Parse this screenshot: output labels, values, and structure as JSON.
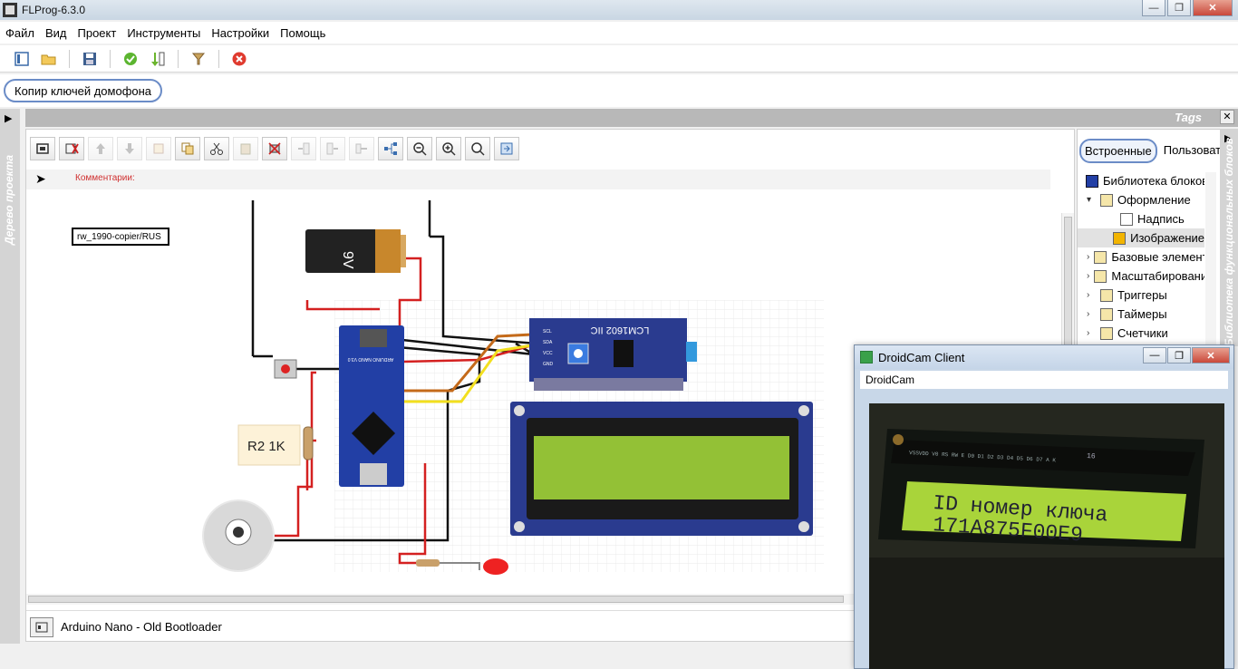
{
  "app": {
    "title": "FLProg-6.3.0"
  },
  "window_controls": {
    "minimize": "—",
    "maximize": "❐",
    "close": "✕"
  },
  "menu": [
    "Файл",
    "Вид",
    "Проект",
    "Инструменты",
    "Настройки",
    "Помощь"
  ],
  "project": {
    "tab_label": "Копир ключей домофона"
  },
  "left_panel": {
    "label": "Дерево проекта"
  },
  "tags_panel": {
    "label": "Tags",
    "hidden_title": "Tags"
  },
  "editor": {
    "comment_label": "Комментарии:",
    "name_box": "rw_1990-copier/RUS",
    "board_label": "Arduino Nano - Old Bootloader"
  },
  "schematic": {
    "battery_label": "9V",
    "resistor_label": "R2 1K",
    "lcd_module_label": "LCM1602 IIC",
    "i2c_pins": [
      "SCL",
      "SDA",
      "VCC",
      "GND"
    ],
    "nano_label": "ARDUINO NANO V3.0"
  },
  "library": {
    "tabs": [
      "Встроенные",
      "Пользоват"
    ],
    "items": [
      {
        "label": "Библиотека блоков",
        "indent": 0,
        "chevron": ""
      },
      {
        "label": "Оформление",
        "indent": 1,
        "chevron": "▾"
      },
      {
        "label": "Надпись",
        "indent": 2,
        "chevron": ""
      },
      {
        "label": "Изображение",
        "indent": 2,
        "chevron": "",
        "selected": true
      },
      {
        "label": "Базовые элементы",
        "indent": 1,
        "chevron": "›"
      },
      {
        "label": "Масштабирование",
        "indent": 1,
        "chevron": "›"
      },
      {
        "label": "Триггеры",
        "indent": 1,
        "chevron": "›"
      },
      {
        "label": "Таймеры",
        "indent": 1,
        "chevron": "›"
      },
      {
        "label": "Счетчики",
        "indent": 1,
        "chevron": "›"
      }
    ],
    "side_label": "Библиотека функциональных блоков"
  },
  "droidcam": {
    "title": "DroidCam Client",
    "menu": "DroidCam",
    "lcd_line1": "ID номер ключа",
    "lcd_line2": "171A875F00E9",
    "lcd_header": "VSSVDD V0 RS RW E D0 D1 D2 D3 D4 D5 D6 D7 A K",
    "lcd_pin16": "16"
  }
}
